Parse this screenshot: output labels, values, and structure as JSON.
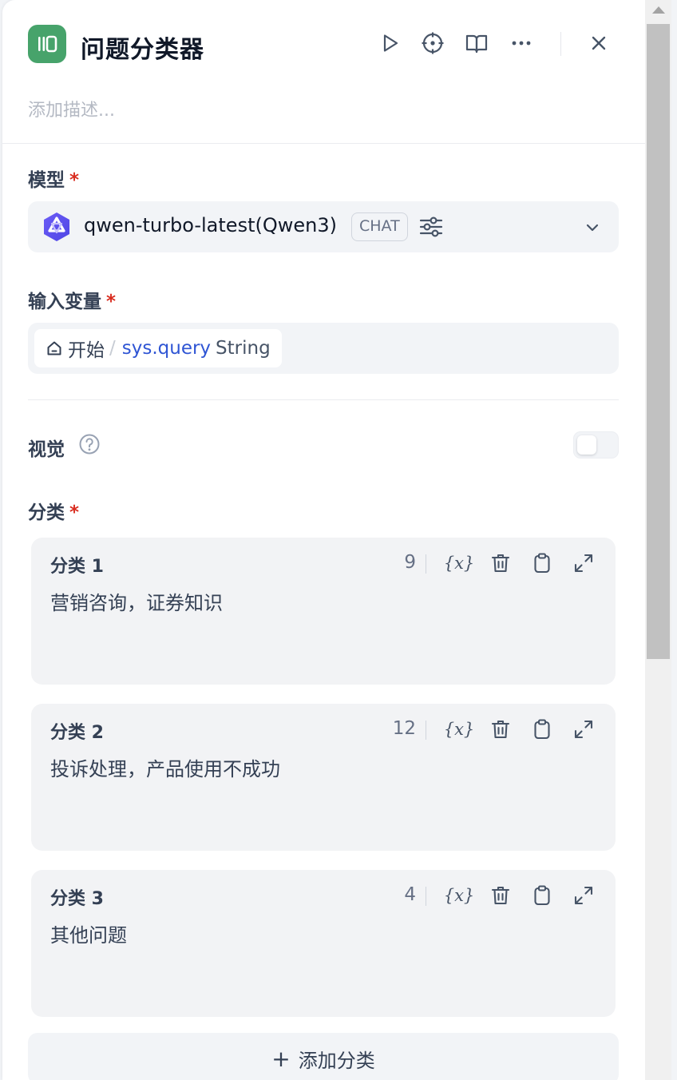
{
  "header": {
    "title": "问题分类器",
    "description_placeholder": "添加描述..."
  },
  "model": {
    "label": "模型",
    "required_mark": "*",
    "name": "qwen-turbo-latest(Qwen3)",
    "mode_badge": "CHAT"
  },
  "input_variable": {
    "label": "输入变量",
    "required_mark": "*",
    "node": "开始",
    "separator": "/",
    "variable": "sys.query",
    "type": "String"
  },
  "vision": {
    "label": "视觉",
    "enabled": false
  },
  "classes": {
    "label": "分类",
    "required_mark": "*",
    "var_icon_text": "{x}",
    "items": [
      {
        "title": "分类 1",
        "count": "9",
        "text": "营销咨询，证券知识"
      },
      {
        "title": "分类 2",
        "count": "12",
        "text": "投诉处理，产品使用不成功"
      },
      {
        "title": "分类 3",
        "count": "4",
        "text": "其他问题"
      }
    ],
    "add_plus": "+",
    "add_label": "添加分类"
  },
  "colors": {
    "accent_green": "#47a36b",
    "variable_blue": "#2f55d4",
    "required_red": "#d92d20"
  }
}
